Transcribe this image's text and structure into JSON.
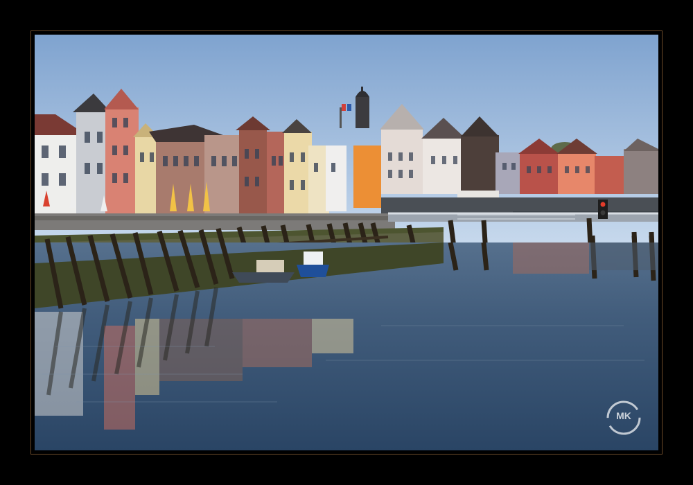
{
  "scene": {
    "subject": "harbour-town-waterfront",
    "colors": {
      "sky_top": "#7fa3cf",
      "sky_bottom": "#c2d5ec",
      "water_top": "#4d6683",
      "water_bottom": "#2b4666",
      "frame_border": "#6b4a2a",
      "matte": "#000000"
    }
  },
  "watermark": {
    "text": "MK"
  }
}
